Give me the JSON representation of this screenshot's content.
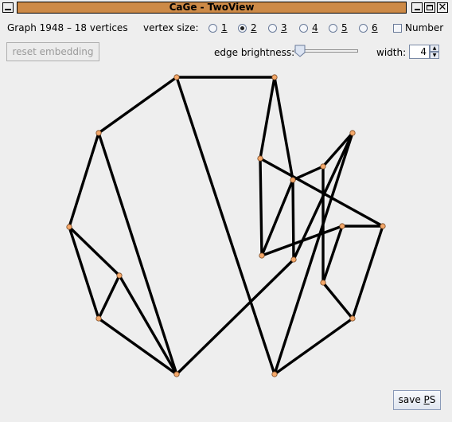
{
  "window": {
    "title": "CaGe - TwoView",
    "close_symbol": "✕"
  },
  "info": {
    "graph_info": "Graph 1948 – 18 vertices"
  },
  "vertex_size": {
    "label": "vertex size:",
    "options": [
      "1",
      "2",
      "3",
      "4",
      "5",
      "6"
    ],
    "selected": "2"
  },
  "number_checkbox": {
    "label": "Number",
    "checked": false
  },
  "reset_button": {
    "label": "reset embedding",
    "enabled": false
  },
  "edge_brightness": {
    "label": "edge brightness:",
    "value": 0.0
  },
  "width_control": {
    "label": "width:",
    "value": "4"
  },
  "save_button": {
    "label_pre": "save ",
    "label_mnemonic": "P",
    "label_post": "S"
  },
  "colors": {
    "title_bar": "#cd8a47",
    "vertex_fill": "#f4a86a",
    "edge": "#000000"
  },
  "graph": {
    "vertex_count": 18,
    "vertices": [
      "v0",
      "v1",
      "v2",
      "v3",
      "v4",
      "v5",
      "v6",
      "v7",
      "v8",
      "v9",
      "v10",
      "v11",
      "v12",
      "v13",
      "v14",
      "v15",
      "v16",
      "v17"
    ],
    "edges": [
      [
        "v0",
        "v1"
      ],
      [
        "v0",
        "v2"
      ],
      [
        "v0",
        "v16"
      ],
      [
        "v1",
        "v9"
      ],
      [
        "v1",
        "v10"
      ],
      [
        "v2",
        "v3"
      ],
      [
        "v2",
        "v6"
      ],
      [
        "v3",
        "v4"
      ],
      [
        "v3",
        "v5"
      ],
      [
        "v4",
        "v5"
      ],
      [
        "v4",
        "v6"
      ],
      [
        "v5",
        "v6"
      ],
      [
        "v7",
        "v8"
      ],
      [
        "v7",
        "v16"
      ],
      [
        "v7",
        "v17"
      ],
      [
        "v8",
        "v9"
      ],
      [
        "v8",
        "v14"
      ],
      [
        "v9",
        "v11"
      ],
      [
        "v9",
        "v17"
      ],
      [
        "v10",
        "v11"
      ],
      [
        "v10",
        "v12"
      ],
      [
        "v11",
        "v13"
      ],
      [
        "v12",
        "v13"
      ],
      [
        "v12",
        "v15"
      ],
      [
        "v13",
        "v14"
      ],
      [
        "v14",
        "v15"
      ],
      [
        "v15",
        "v16"
      ],
      [
        "v6",
        "v17"
      ]
    ]
  }
}
